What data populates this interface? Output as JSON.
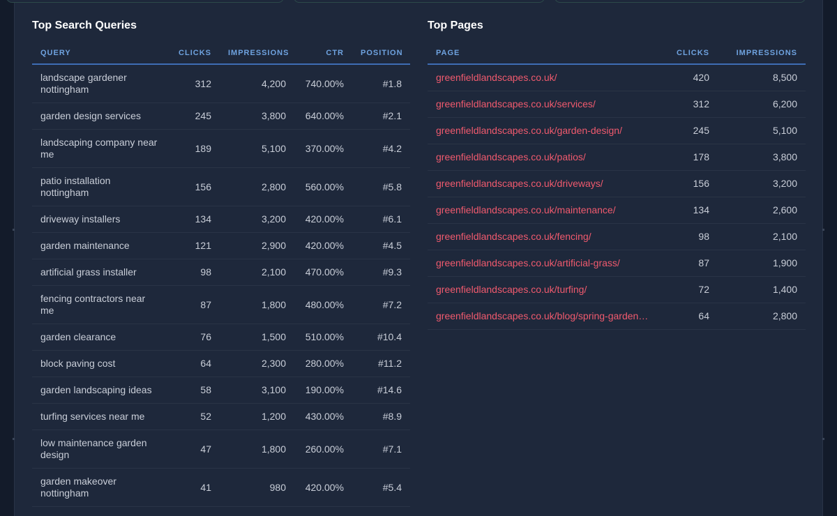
{
  "queries": {
    "title": "Top Search Queries",
    "headers": {
      "query": "QUERY",
      "clicks": "CLICKS",
      "impressions": "IMPRESSIONS",
      "ctr": "CTR",
      "position": "POSITION"
    },
    "rows": [
      {
        "query": "landscape gardener nottingham",
        "clicks": "312",
        "impressions": "4,200",
        "ctr": "740.00%",
        "position": "#1.8"
      },
      {
        "query": "garden design services",
        "clicks": "245",
        "impressions": "3,800",
        "ctr": "640.00%",
        "position": "#2.1"
      },
      {
        "query": "landscaping company near me",
        "clicks": "189",
        "impressions": "5,100",
        "ctr": "370.00%",
        "position": "#4.2"
      },
      {
        "query": "patio installation nottingham",
        "clicks": "156",
        "impressions": "2,800",
        "ctr": "560.00%",
        "position": "#5.8"
      },
      {
        "query": "driveway installers",
        "clicks": "134",
        "impressions": "3,200",
        "ctr": "420.00%",
        "position": "#6.1"
      },
      {
        "query": "garden maintenance",
        "clicks": "121",
        "impressions": "2,900",
        "ctr": "420.00%",
        "position": "#4.5"
      },
      {
        "query": "artificial grass installer",
        "clicks": "98",
        "impressions": "2,100",
        "ctr": "470.00%",
        "position": "#9.3"
      },
      {
        "query": "fencing contractors near me",
        "clicks": "87",
        "impressions": "1,800",
        "ctr": "480.00%",
        "position": "#7.2"
      },
      {
        "query": "garden clearance",
        "clicks": "76",
        "impressions": "1,500",
        "ctr": "510.00%",
        "position": "#10.4"
      },
      {
        "query": "block paving cost",
        "clicks": "64",
        "impressions": "2,300",
        "ctr": "280.00%",
        "position": "#11.2"
      },
      {
        "query": "garden landscaping ideas",
        "clicks": "58",
        "impressions": "3,100",
        "ctr": "190.00%",
        "position": "#14.6"
      },
      {
        "query": "turfing services near me",
        "clicks": "52",
        "impressions": "1,200",
        "ctr": "430.00%",
        "position": "#8.9"
      },
      {
        "query": "low maintenance garden design",
        "clicks": "47",
        "impressions": "1,800",
        "ctr": "260.00%",
        "position": "#7.1"
      },
      {
        "query": "garden makeover nottingham",
        "clicks": "41",
        "impressions": "980",
        "ctr": "420.00%",
        "position": "#5.4"
      }
    ]
  },
  "pages": {
    "title": "Top Pages",
    "headers": {
      "page": "PAGE",
      "clicks": "CLICKS",
      "impressions": "IMPRESSIONS"
    },
    "rows": [
      {
        "page": "greenfieldlandscapes.co.uk/",
        "clicks": "420",
        "impressions": "8,500"
      },
      {
        "page": "greenfieldlandscapes.co.uk/services/",
        "clicks": "312",
        "impressions": "6,200"
      },
      {
        "page": "greenfieldlandscapes.co.uk/garden-design/",
        "clicks": "245",
        "impressions": "5,100"
      },
      {
        "page": "greenfieldlandscapes.co.uk/patios/",
        "clicks": "178",
        "impressions": "3,800"
      },
      {
        "page": "greenfieldlandscapes.co.uk/driveways/",
        "clicks": "156",
        "impressions": "3,200"
      },
      {
        "page": "greenfieldlandscapes.co.uk/maintenance/",
        "clicks": "134",
        "impressions": "2,600"
      },
      {
        "page": "greenfieldlandscapes.co.uk/fencing/",
        "clicks": "98",
        "impressions": "2,100"
      },
      {
        "page": "greenfieldlandscapes.co.uk/artificial-grass/",
        "clicks": "87",
        "impressions": "1,900"
      },
      {
        "page": "greenfieldlandscapes.co.uk/turfing/",
        "clicks": "72",
        "impressions": "1,400"
      },
      {
        "page": "greenfieldlandscapes.co.uk/blog/spring-garden…",
        "clicks": "64",
        "impressions": "2,800"
      }
    ]
  },
  "colors": {
    "background": "#131b2a",
    "panel": "#1e283b",
    "header_text": "#6fa3e0",
    "header_rule": "#3e6db5",
    "link": "#f05a6e",
    "cell_text": "#c9ced8"
  }
}
